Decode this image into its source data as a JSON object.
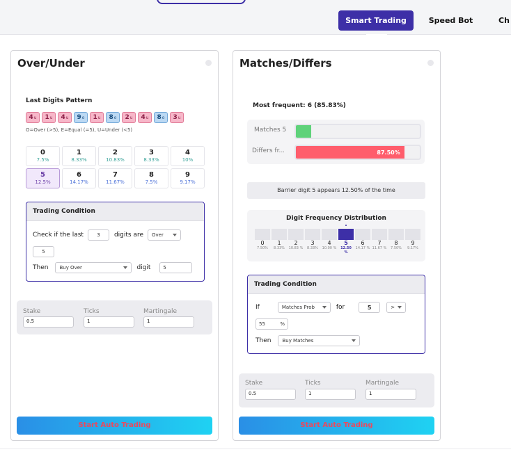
{
  "nav": {
    "tabs": [
      {
        "label": "Smart Trading",
        "active": true
      },
      {
        "label": "Speed Bot"
      },
      {
        "label": "Ch"
      }
    ]
  },
  "colors": {
    "accent": "#3d2fa7",
    "under": "#f7b7c9",
    "over": "#bcd9f3",
    "matches": "#5fd27a",
    "differs": "#ff5d6c"
  },
  "over_under": {
    "title": "Over/Under",
    "pattern_title": "Last Digits Pattern",
    "chips": [
      {
        "d": "4",
        "t": "U"
      },
      {
        "d": "1",
        "t": "U"
      },
      {
        "d": "4",
        "t": "U"
      },
      {
        "d": "9",
        "t": "O"
      },
      {
        "d": "1",
        "t": "U"
      },
      {
        "d": "8",
        "t": "O"
      },
      {
        "d": "2",
        "t": "U"
      },
      {
        "d": "4",
        "t": "U"
      },
      {
        "d": "8",
        "t": "O"
      },
      {
        "d": "3",
        "t": "U"
      }
    ],
    "legend": "O=Over (>5), E=Equal (=5), U=Under (<5)",
    "digits": [
      {
        "d": "0",
        "p": "7.5%"
      },
      {
        "d": "1",
        "p": "8.33%"
      },
      {
        "d": "2",
        "p": "10.83%"
      },
      {
        "d": "3",
        "p": "8.33%"
      },
      {
        "d": "4",
        "p": "10%"
      },
      {
        "d": "5",
        "p": "12.5%"
      },
      {
        "d": "6",
        "p": "14.17%"
      },
      {
        "d": "7",
        "p": "11.67%"
      },
      {
        "d": "8",
        "p": "7.5%"
      },
      {
        "d": "9",
        "p": "9.17%"
      }
    ],
    "tc": {
      "title": "Trading Condition",
      "check_label": "Check if the last",
      "last_value": "3",
      "digits_are": "digits are",
      "compare": "Over",
      "compare_value": "5",
      "then": "Then",
      "action": "Buy Over",
      "digit_label": "digit",
      "digit_value": "5"
    },
    "stake": {
      "stake_label": "Stake",
      "stake_value": "0.5",
      "ticks_label": "Ticks",
      "ticks_value": "1",
      "mart_label": "Martingale",
      "mart_value": "1"
    },
    "start": "Start Auto Trading"
  },
  "matches_differs": {
    "title": "Matches/Differs",
    "most_frequent": "Most frequent: 6 (85.83%)",
    "matches_label": "Matches 5",
    "matches_fraction": 0.125,
    "differs_label": "Differs fr...",
    "differs_pct": "87.50%",
    "differs_fraction": 0.875,
    "barrier_text": "Barrier digit 5 appears 12.50% of the time",
    "dist_title": "Digit Frequency Distribution",
    "dist": [
      {
        "d": "0",
        "p": "7.50%"
      },
      {
        "d": "1",
        "p": "8.33%"
      },
      {
        "d": "2",
        "p": "10.83 %"
      },
      {
        "d": "3",
        "p": "8.33%"
      },
      {
        "d": "4",
        "p": "10.00 %"
      },
      {
        "d": "5",
        "p": "12.50 %"
      },
      {
        "d": "6",
        "p": "14.17 %"
      },
      {
        "d": "7",
        "p": "11.67 %"
      },
      {
        "d": "8",
        "p": "7.50%"
      },
      {
        "d": "9",
        "p": "9.17%"
      }
    ],
    "tc": {
      "title": "Trading Condition",
      "if_label": "If",
      "condition": "Matches Prob",
      "for_label": "for",
      "for_value": "5",
      "operator": ">",
      "threshold": "55",
      "pct": "%",
      "then": "Then",
      "action": "Buy Matches"
    },
    "stake": {
      "stake_label": "Stake",
      "stake_value": "0.5",
      "ticks_label": "Ticks",
      "ticks_value": "1",
      "mart_label": "Martingale",
      "mart_value": "1"
    },
    "start": "Start Auto Trading"
  }
}
